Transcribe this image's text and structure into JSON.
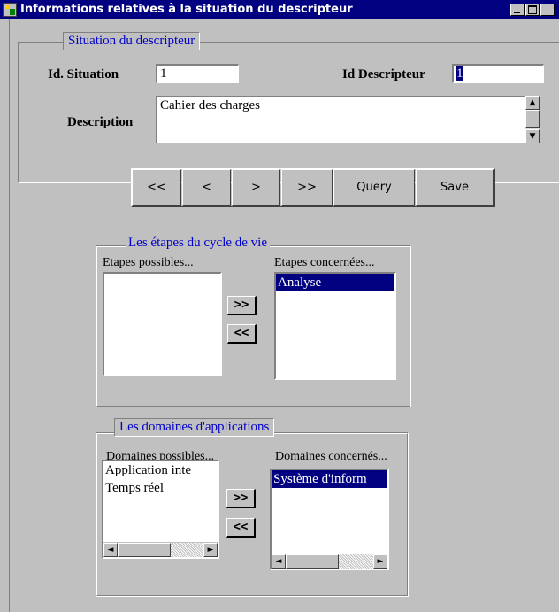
{
  "window": {
    "title": "Informations relatives à la situation du descripteur",
    "icon": "app-icon",
    "controls": [
      "minimize-icon",
      "maximize-icon",
      "close-icon"
    ]
  },
  "situation": {
    "legend": "Situation du descripteur",
    "id_situation_label": "Id. Situation",
    "id_situation_value": "1",
    "id_descripteur_label": "Id Descripteur",
    "id_descripteur_value": "1",
    "description_label": "Description",
    "description_value": "Cahier des charges"
  },
  "toolbar": {
    "first": "<<",
    "prev": "<",
    "next": ">",
    "last": ">>",
    "query": "Query",
    "save": "Save"
  },
  "etapes": {
    "legend": "Les étapes du cycle de vie",
    "possible_label": "Etapes possibles...",
    "possible_items": [],
    "concerned_label": "Etapes concernées...",
    "concerned_items": [
      "Analyse"
    ],
    "add_button": ">>",
    "remove_button": "<<"
  },
  "domaines": {
    "legend": "Les domaines d'applications",
    "possible_label": "Domaines possibles...",
    "possible_items": [
      "Application inte",
      "Temps réel"
    ],
    "concerned_label": "Domaines concernés...",
    "concerned_items": [
      "Système d'inform"
    ],
    "add_button": ">>",
    "remove_button": "<<"
  },
  "colors": {
    "titlebar": "#000080",
    "face": "#c0c0c0",
    "legend_text": "#0000c8",
    "selection": "#000080"
  }
}
